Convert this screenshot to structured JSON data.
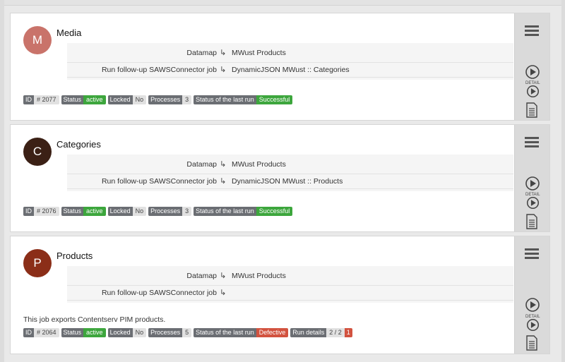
{
  "cards": [
    {
      "avatar_letter": "M",
      "avatar_color": "#c9736a",
      "title": "Media",
      "datamap_label": "Datamap",
      "datamap_value": "MWust Products",
      "followup_label": "Run follow-up SAWSConnector job",
      "followup_value": "DynamicJSON MWust :: Categories",
      "description": "",
      "badges": {
        "id_key": "ID",
        "id_val": "# 2077",
        "status_key": "Status",
        "status_val": "active",
        "locked_key": "Locked",
        "locked_val": "No",
        "processes_key": "Processes",
        "processes_val": "3",
        "lastrun_key": "Status of the last run",
        "lastrun_val": "Successful"
      }
    },
    {
      "avatar_letter": "C",
      "avatar_color": "#3b2015",
      "title": "Categories",
      "datamap_label": "Datamap",
      "datamap_value": "MWust Products",
      "followup_label": "Run follow-up SAWSConnector job",
      "followup_value": "DynamicJSON MWust :: Products",
      "description": "",
      "badges": {
        "id_key": "ID",
        "id_val": "# 2076",
        "status_key": "Status",
        "status_val": "active",
        "locked_key": "Locked",
        "locked_val": "No",
        "processes_key": "Processes",
        "processes_val": "3",
        "lastrun_key": "Status of the last run",
        "lastrun_val": "Successful"
      }
    },
    {
      "avatar_letter": "P",
      "avatar_color": "#8b2e18",
      "title": "Products",
      "datamap_label": "Datamap",
      "datamap_value": "MWust Products",
      "followup_label": "Run follow-up SAWSConnector job",
      "followup_value": "",
      "description": "This job exports Contentserv PIM products.",
      "badges": {
        "id_key": "ID",
        "id_val": "# 2064",
        "status_key": "Status",
        "status_val": "active",
        "locked_key": "Locked",
        "locked_val": "No",
        "processes_key": "Processes",
        "processes_val": "5",
        "lastrun_key": "Status of the last run",
        "lastrun_val": "Defective",
        "rundetails_key": "Run details",
        "rundetails_val": "2 / 2",
        "rundetails_count": "1"
      }
    }
  ],
  "side": {
    "detail_label": "DETAIL"
  },
  "icons": {
    "arrow": "↳",
    "menu": "menu-icon",
    "play": "play-icon",
    "document": "document-icon"
  }
}
